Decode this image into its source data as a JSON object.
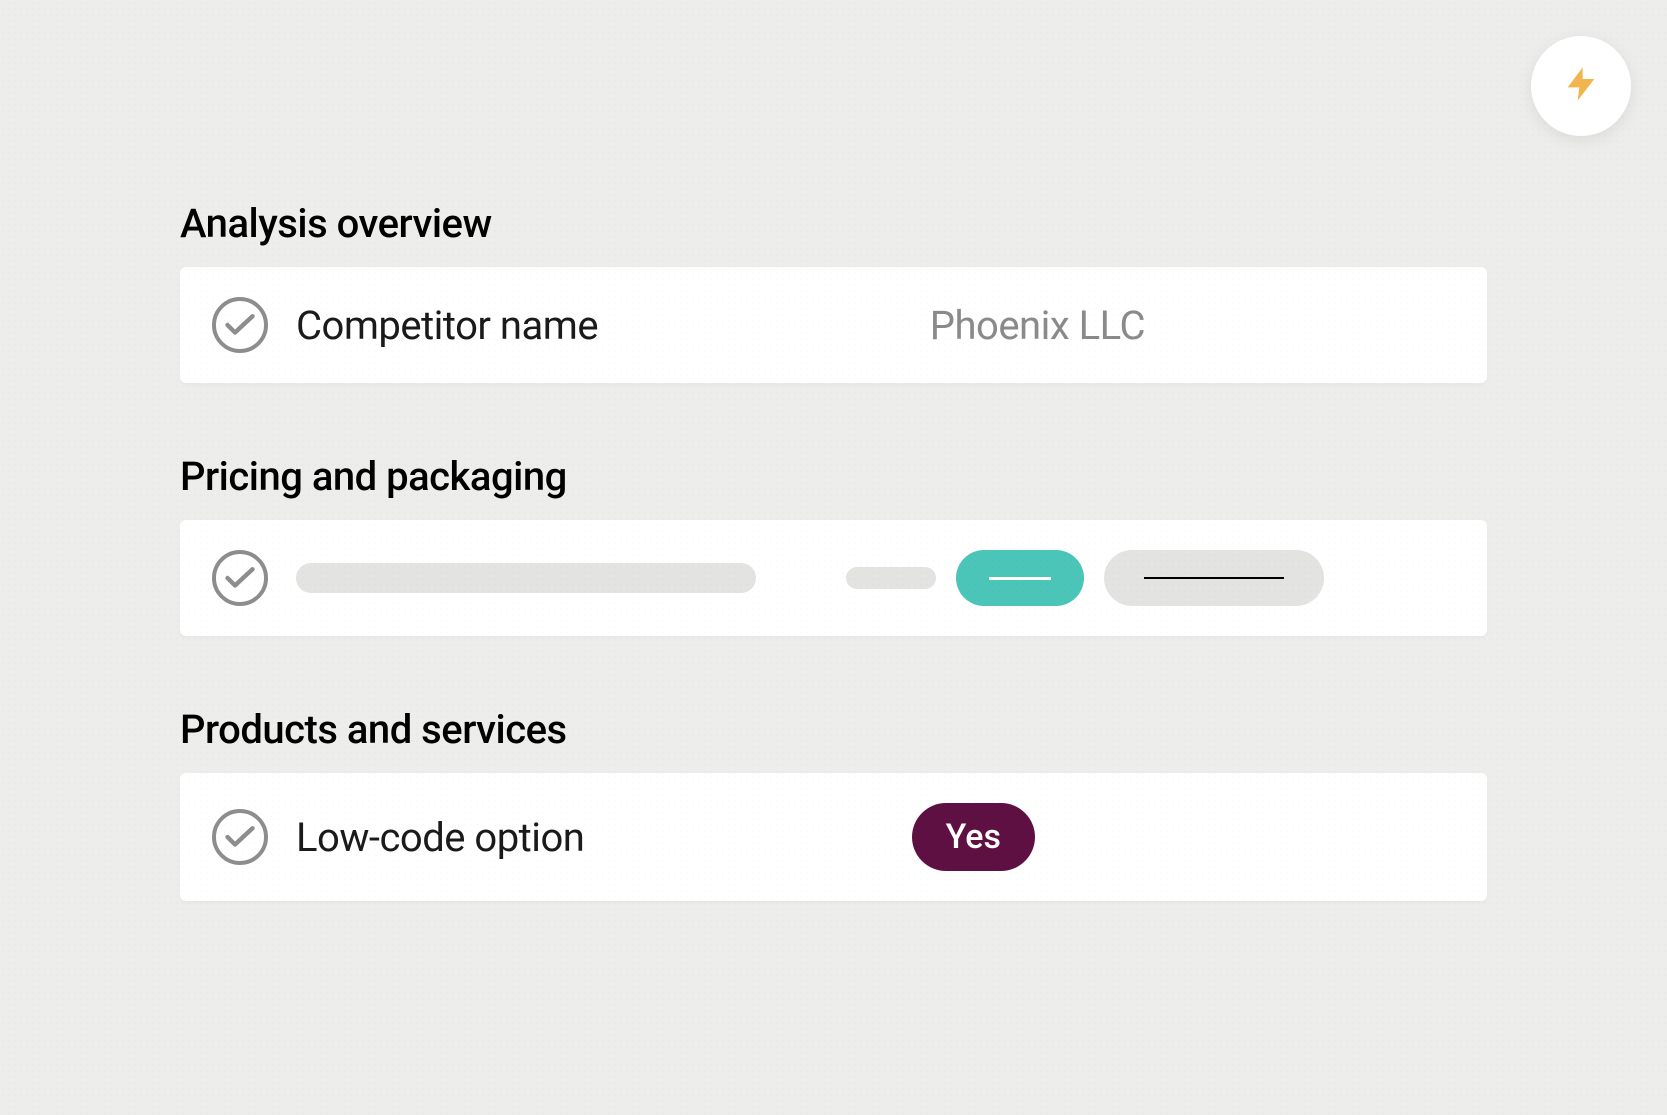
{
  "action_button_icon": "lightning-icon",
  "colors": {
    "accent_teal": "#4bc5b8",
    "accent_maroon": "#5f1043",
    "accent_amber": "#f0b54e"
  },
  "sections": {
    "analysis": {
      "heading": "Analysis overview",
      "row": {
        "label": "Competitor name",
        "value": "Phoenix LLC"
      }
    },
    "pricing": {
      "heading": "Pricing and packaging"
    },
    "products": {
      "heading": "Products and services",
      "row": {
        "label": "Low-code option",
        "value": "Yes"
      }
    }
  }
}
